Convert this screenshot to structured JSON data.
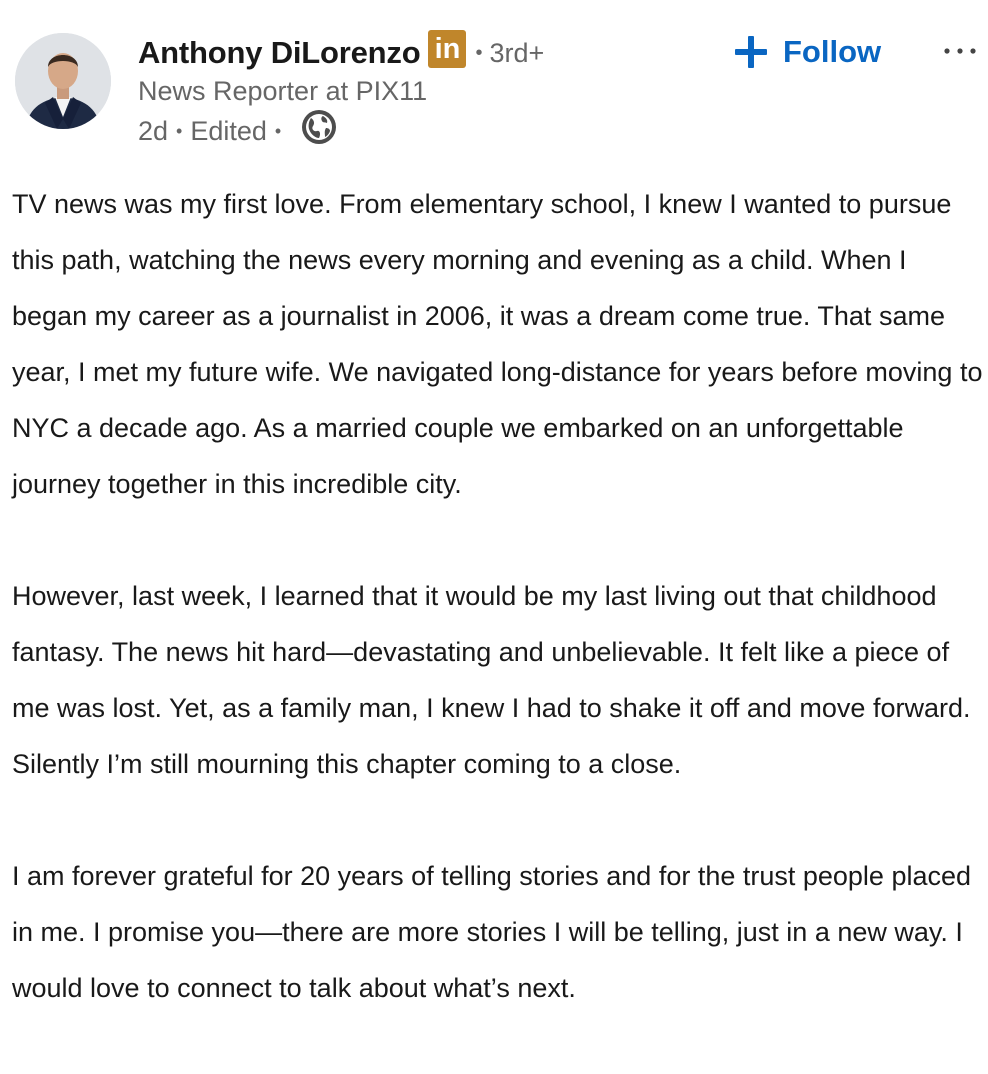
{
  "author": {
    "name": "Anthony DiLorenzo",
    "badge": "in",
    "degree_separator": "•",
    "degree": "3rd+",
    "headline": "News Reporter at PIX11",
    "avatar_icon": "profile-photo"
  },
  "meta": {
    "time": "2d",
    "separator": "•",
    "edited": "Edited",
    "separator2": "•",
    "visibility_icon": "globe-icon"
  },
  "actions": {
    "follow_label": "Follow",
    "follow_icon": "plus-icon",
    "more_icon": "ellipsis-icon"
  },
  "colors": {
    "accent": "#0a66c2",
    "premium_badge": "#c0862b",
    "text_primary": "#191919",
    "text_secondary": "#666666"
  },
  "body": {
    "paragraphs": [
      "TV news was my first love. From elementary school, I knew I wanted to pursue this path, watching the news every morning and evening as a child. When I began my career as a journalist in 2006, it was a dream come true. That same year, I met my future wife. We navigated long-distance for years before moving to NYC a decade ago. As a married couple we embarked on an unforgettable journey together in this incredible city.",
      "However, last week, I learned that it would be my last living out that childhood fantasy. The news hit hard—devastating and unbelievable. It felt like a piece of me was lost. Yet, as a family man, I knew I had to shake it off and move forward. Silently I’m still mourning this chapter coming to a close.",
      "I am forever grateful for 20 years of telling stories and for the trust people placed in me. I promise you—there are more stories I will be telling, just in a new way. I would love to connect to talk about what’s next."
    ]
  }
}
